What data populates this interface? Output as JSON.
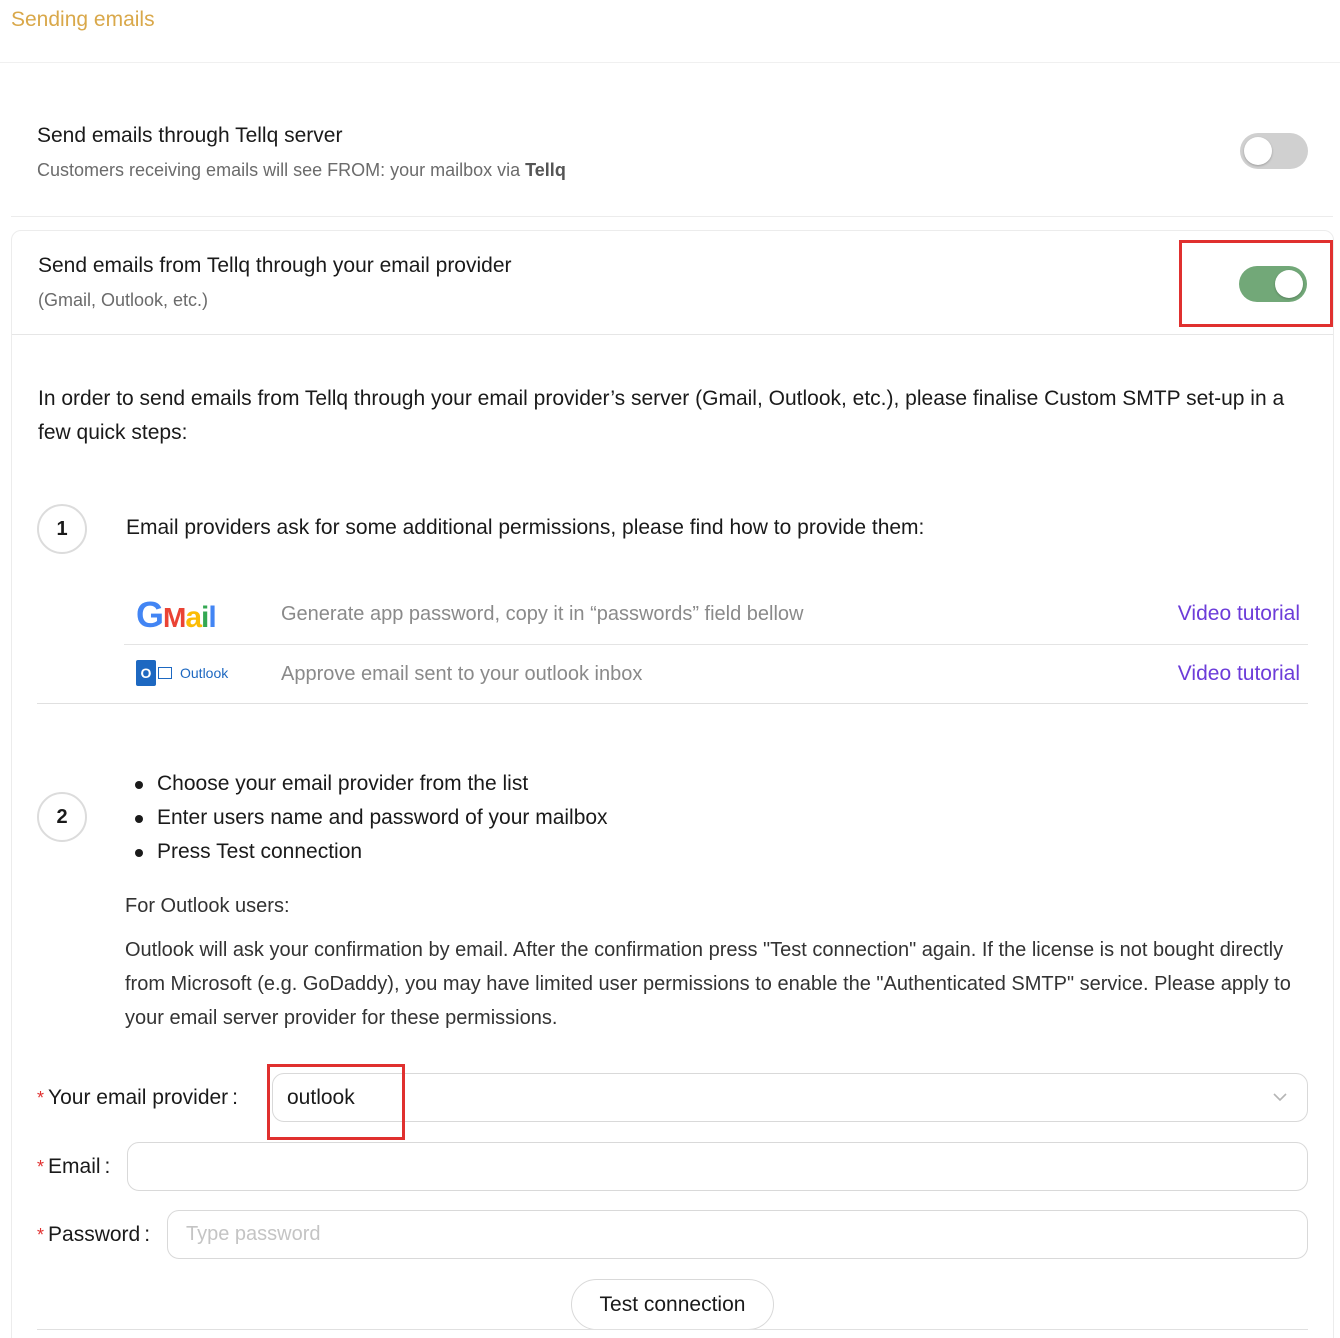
{
  "header": {
    "title": "Sending emails"
  },
  "tellq_server": {
    "title": "Send emails through Tellq server",
    "subtitle_prefix": "Customers receiving emails will see FROM: your mailbox via ",
    "subtitle_brand": "Tellq",
    "toggle_state": "off"
  },
  "provider_option": {
    "title": "Send emails from Tellq through your email provider",
    "subtitle": "(Gmail, Outlook, etc.)",
    "toggle_state": "on",
    "toggle_color": "#72a878"
  },
  "intro_text": "In order to send emails from Tellq through your email provider’s server (Gmail, Outlook, etc.), please finalise Custom SMTP set-up in a few quick steps:",
  "step1": {
    "number": "1",
    "text": "Email providers ask for some additional permissions, please find how to provide them:",
    "providers": [
      {
        "logo": "gmail-logo",
        "description": "Generate app password, copy it in “passwords” field bellow",
        "link": "Video tutorial"
      },
      {
        "logo": "outlook-logo",
        "logo_text": "Outlook",
        "logo_letter": "O",
        "description": "Approve email sent to your outlook inbox",
        "link": "Video tutorial"
      }
    ]
  },
  "step2": {
    "number": "2",
    "bullets": [
      "Choose your email provider from the list",
      "Enter users name and password of your mailbox",
      "Press Test connection"
    ],
    "note_title": "For Outlook users:",
    "note": "Outlook will ask your confirmation by email. After the confirmation press \"Test connection\" again. If the license is not bought directly from Microsoft (e.g. GoDaddy), you may have limited user permissions to enable the \"Authenticated SMTP\" service. Please apply to your email server provider for these permissions."
  },
  "form": {
    "required_mark": "*",
    "colon": ":",
    "provider_label": "Your email provider",
    "provider_value": "outlook",
    "email_label": "Email",
    "email_value": "",
    "password_label": "Password",
    "password_placeholder": "Type password",
    "test_button": "Test connection"
  },
  "colors": {
    "accent": "#d9a84a",
    "link": "#6c3cd9",
    "highlight": "#e0302f"
  }
}
